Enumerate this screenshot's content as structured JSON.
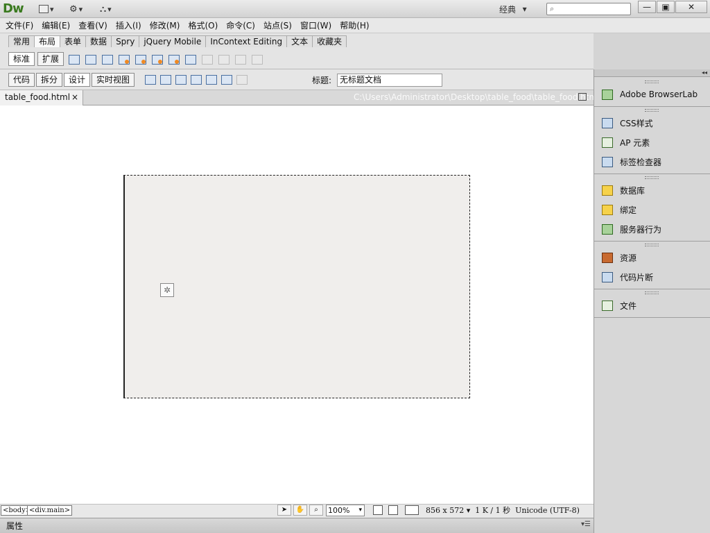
{
  "app": {
    "logo": "Dw",
    "workspace": "经典"
  },
  "window_controls": {
    "minimize": "—",
    "restore": "▣",
    "close": "✕"
  },
  "menu": [
    "文件(F)",
    "编辑(E)",
    "查看(V)",
    "插入(I)",
    "修改(M)",
    "格式(O)",
    "命令(C)",
    "站点(S)",
    "窗口(W)",
    "帮助(H)"
  ],
  "insert_tabs": [
    "常用",
    "布局",
    "表单",
    "数据",
    "Spry",
    "jQuery Mobile",
    "InContext Editing",
    "文本",
    "收藏夹"
  ],
  "insert_active_tab": "布局",
  "layout_modes": [
    "标准",
    "扩展"
  ],
  "view_buttons": [
    "代码",
    "拆分",
    "设计",
    "实时视图"
  ],
  "document": {
    "title_label": "标题:",
    "title_value": "无标题文档",
    "file_tab": "table_food.html",
    "file_tab_close": "×",
    "file_path": "C:\\Users\\Administrator\\Desktop\\table_food\\table_food.html"
  },
  "status": {
    "tags": [
      "<body>",
      "<div.main>"
    ],
    "zoom": "100%",
    "size": "856 x 572",
    "weight": "1 K / 1 秒",
    "encoding": "Unicode (UTF-8)"
  },
  "properties": {
    "label": "属性"
  },
  "panels": [
    {
      "items": [
        {
          "label": "Adobe BrowserLab",
          "icon": "browserlab-icon"
        }
      ]
    },
    {
      "items": [
        {
          "label": "CSS样式",
          "icon": "css-styles-icon"
        },
        {
          "label": "AP 元素",
          "icon": "ap-elements-icon"
        },
        {
          "label": "标签检查器",
          "icon": "tag-inspector-icon"
        }
      ]
    },
    {
      "items": [
        {
          "label": "数据库",
          "icon": "database-icon"
        },
        {
          "label": "绑定",
          "icon": "bindings-icon"
        },
        {
          "label": "服务器行为",
          "icon": "server-behaviors-icon"
        }
      ]
    },
    {
      "items": [
        {
          "label": "资源",
          "icon": "assets-icon"
        },
        {
          "label": "代码片断",
          "icon": "snippets-icon"
        }
      ]
    },
    {
      "items": [
        {
          "label": "文件",
          "icon": "files-icon"
        }
      ]
    }
  ]
}
